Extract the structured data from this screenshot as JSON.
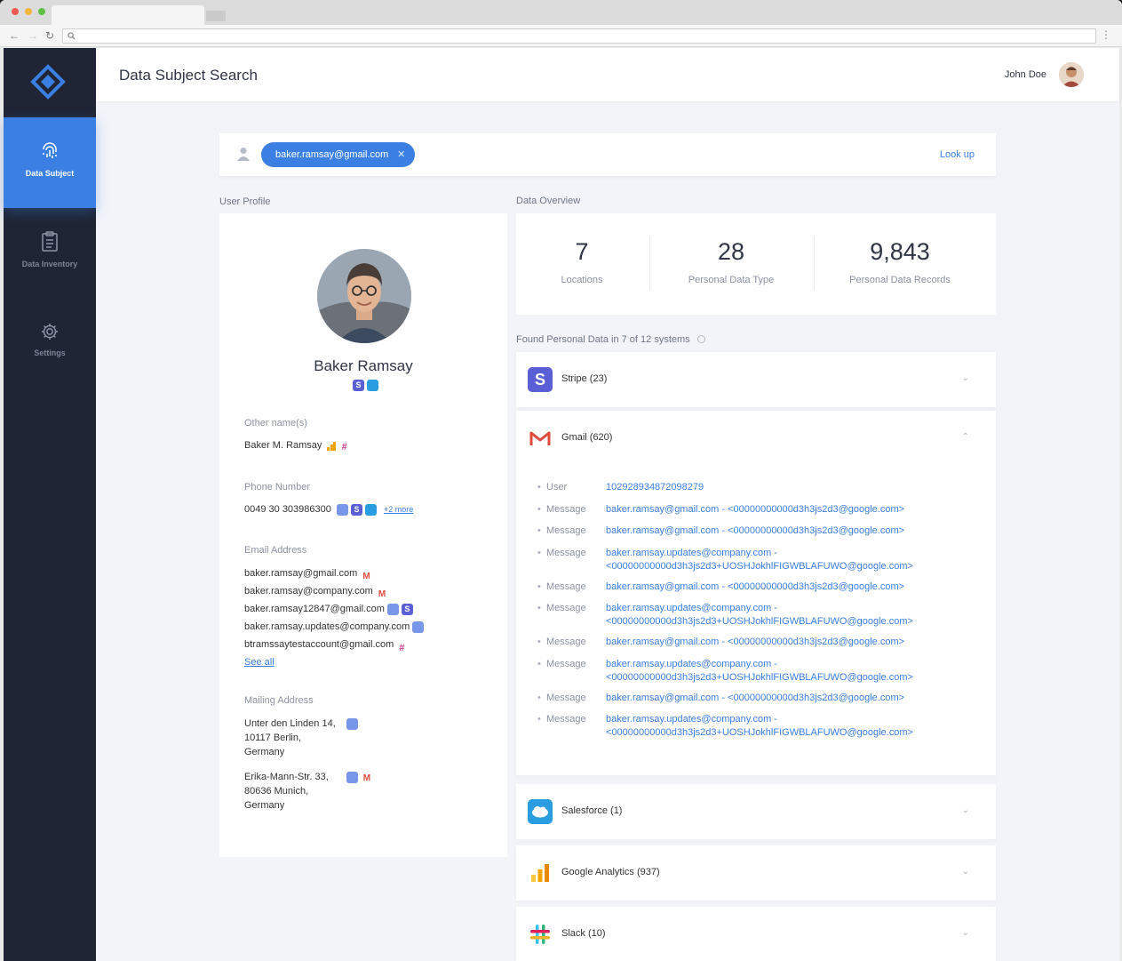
{
  "header": {
    "title": "Data Subject Search",
    "user_name": "John Doe"
  },
  "sidebar": {
    "items": [
      {
        "label": "Data Subject",
        "icon": "fingerprint-icon",
        "active": true
      },
      {
        "label": "Data Inventory",
        "icon": "clipboard-icon",
        "active": false
      },
      {
        "label": "Settings",
        "icon": "gear-icon",
        "active": false
      }
    ]
  },
  "search": {
    "chip_value": "baker.ramsay@gmail.com",
    "lookup_label": "Look up"
  },
  "sections": {
    "user_profile": "User Profile",
    "data_overview": "Data Overview",
    "found_systems": "Found Personal Data in 7 of 12 systems"
  },
  "profile": {
    "name": "Baker Ramsay",
    "other_names_label": "Other name(s)",
    "other_names_value": "Baker M. Ramsay",
    "phone_label": "Phone Number",
    "phone_value": "0049 30 303986300",
    "phone_more": "+2 more",
    "email_label": "Email Address",
    "emails": [
      "baker.ramsay@gmail.com",
      "baker.ramsay@company.com",
      "baker.ramsay12847@gmail.com",
      "baker.ramsay.updates@company.com",
      "btramssaytestaccount@gmail.com"
    ],
    "see_all": "See all",
    "mailing_label": "Mailing Address",
    "addresses": [
      {
        "line1": "Unter den Linden 14,",
        "line2": "10117 Berlin,",
        "line3": "Germany"
      },
      {
        "line1": "Erika-Mann-Str. 33,",
        "line2": "80636 Munich,",
        "line3": "Germany"
      }
    ]
  },
  "overview": {
    "stats": [
      {
        "value": "7",
        "label": "Locations"
      },
      {
        "value": "28",
        "label": "Personal Data Type"
      },
      {
        "value": "9,843",
        "label": "Personal Data Records"
      }
    ]
  },
  "systems": [
    {
      "name": "Stripe (23)",
      "icon": "stripe-logo-icon"
    },
    {
      "name": "Gmail (620)",
      "icon": "gmail-logo-icon"
    },
    {
      "name": "Salesforce (1)",
      "icon": "salesforce-logo-icon"
    },
    {
      "name": "Google Analytics (937)",
      "icon": "google-analytics-logo-icon"
    },
    {
      "name": "Slack (10)",
      "icon": "slack-logo-icon"
    }
  ],
  "gmail_records": [
    {
      "label": "User",
      "line1": "102928934872098279",
      "line2": ""
    },
    {
      "label": "Message",
      "line1": "baker.ramsay@gmail.com - <00000000000d3h3js2d3@google.com>",
      "line2": ""
    },
    {
      "label": "Message",
      "line1": "baker.ramsay@gmail.com - <00000000000d3h3js2d3@google.com>",
      "line2": ""
    },
    {
      "label": "Message",
      "line1": "baker.ramsay.updates@company.com -",
      "line2": "<00000000000d3h3js2d3+UOSHJokhlFIGWBLAFUWO@google.com>"
    },
    {
      "label": "Message",
      "line1": "baker.ramsay@gmail.com - <00000000000d3h3js2d3@google.com>",
      "line2": ""
    },
    {
      "label": "Message",
      "line1": "baker.ramsay.updates@company.com -",
      "line2": "<00000000000d3h3js2d3+UOSHJokhlFIGWBLAFUWO@google.com>"
    },
    {
      "label": "Message",
      "line1": "baker.ramsay@gmail.com - <00000000000d3h3js2d3@google.com>",
      "line2": ""
    },
    {
      "label": "Message",
      "line1": "baker.ramsay.updates@company.com -",
      "line2": "<00000000000d3h3js2d3+UOSHJokhlFIGWBLAFUWO@google.com>"
    },
    {
      "label": "Message",
      "line1": "baker.ramsay@gmail.com - <00000000000d3h3js2d3@google.com>",
      "line2": ""
    },
    {
      "label": "Message",
      "line1": "baker.ramsay.updates@company.com -",
      "line2": "<00000000000d3h3js2d3+UOSHJokhlFIGWBLAFUWO@google.com>"
    }
  ],
  "colors": {
    "accent": "#3b7fe3",
    "sidebar": "#1f2534",
    "stripe": "#5b5fd6",
    "gmail": "#e04a3c",
    "salesforce": "#2a9ce0"
  }
}
